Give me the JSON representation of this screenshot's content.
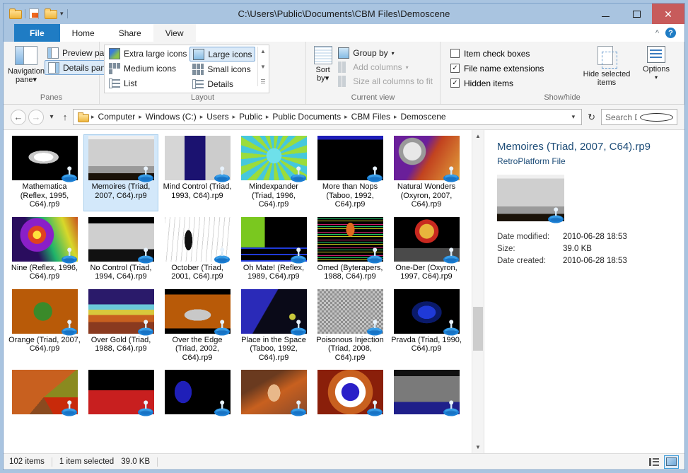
{
  "window": {
    "title": "C:\\Users\\Public\\Documents\\CBM Files\\Demoscene",
    "minimize_label": "Minimize",
    "maximize_label": "Maximize",
    "close_label": "Close",
    "help_label": "?",
    "collapse_ribbon_label": "^"
  },
  "quick_access": {
    "folder_icon": "folder-icon",
    "properties_icon": "properties-icon",
    "new_folder_icon": "new-folder-icon",
    "dropdown_icon": "chevron-down-icon"
  },
  "tabs": [
    {
      "label": "File",
      "state": "file"
    },
    {
      "label": "Home",
      "state": "normal"
    },
    {
      "label": "Share",
      "state": "normal"
    },
    {
      "label": "View",
      "state": "selected"
    }
  ],
  "ribbon": {
    "groups": [
      {
        "title": "Panes",
        "big_button": {
          "label_line1": "Navigation",
          "label_line2": "pane",
          "icon": "navigation-pane-icon"
        },
        "items": [
          {
            "label": "Preview pane",
            "icon": "preview-pane-icon",
            "highlighted": false
          },
          {
            "label": "Details pane",
            "icon": "details-pane-icon",
            "highlighted": true
          }
        ]
      },
      {
        "title": "Layout",
        "items": [
          {
            "label": "Extra large icons",
            "icon": "extra-large-icons-icon",
            "highlighted": false
          },
          {
            "label": "Medium icons",
            "icon": "medium-icons-icon",
            "highlighted": false
          },
          {
            "label": "List",
            "icon": "list-icon",
            "highlighted": false
          },
          {
            "label": "Large icons",
            "icon": "large-icons-icon",
            "highlighted": true
          },
          {
            "label": "Small icons",
            "icon": "small-icons-icon",
            "highlighted": false
          },
          {
            "label": "Details",
            "icon": "details-icon",
            "highlighted": false
          }
        ],
        "spinner": {
          "up": "▲",
          "down": "▼",
          "more": "☰"
        }
      },
      {
        "title": "Current view",
        "big_button": {
          "label_line1": "Sort",
          "label_line2": "by",
          "icon": "sort-by-icon"
        },
        "items": [
          {
            "label": "Group by",
            "icon": "group-by-icon",
            "disabled": false,
            "dropdown": true
          },
          {
            "label": "Add columns",
            "icon": "add-columns-icon",
            "disabled": true,
            "dropdown": true
          },
          {
            "label": "Size all columns to fit",
            "icon": "size-columns-icon",
            "disabled": true,
            "dropdown": false
          }
        ]
      },
      {
        "title": "Show/hide",
        "checkboxes": [
          {
            "label": "Item check boxes",
            "checked": false
          },
          {
            "label": "File name extensions",
            "checked": true
          },
          {
            "label": "Hidden items",
            "checked": true
          }
        ],
        "hide_selected": {
          "label_line1": "Hide selected",
          "label_line2": "items",
          "icon": "hide-selected-items-icon"
        },
        "options": {
          "label": "Options",
          "icon": "options-icon",
          "dropdown": "▾"
        }
      }
    ]
  },
  "address_bar": {
    "back_icon": "back-arrow-icon",
    "forward_icon": "forward-arrow-icon",
    "recent_icon": "chevron-down-icon",
    "up_icon": "up-arrow-icon",
    "folder_icon": "folder-icon",
    "crumbs": [
      "Computer",
      "Windows (C:)",
      "Users",
      "Public",
      "Public Documents",
      "CBM Files",
      "Demoscene"
    ],
    "separator": "▸",
    "dropdown_icon": "chevron-down-icon",
    "refresh_icon": "refresh-icon",
    "search_placeholder": "Search De...",
    "search_value": "",
    "search_icon": "search-icon"
  },
  "files": [
    {
      "name": "Mathematica (Reflex, 1995, C64).rp9",
      "selected": false,
      "thumb": "mathematica"
    },
    {
      "name": "Memoires (Triad, 2007, C64).rp9",
      "selected": true,
      "thumb": "memoires"
    },
    {
      "name": "Mind Control (Triad, 1993, C64).rp9",
      "selected": false,
      "thumb": "mindcontrol"
    },
    {
      "name": "Mindexpander (Triad, 1996, C64).rp9",
      "selected": false,
      "thumb": "mindexpander"
    },
    {
      "name": "More than Nops (Taboo, 1992, C64).rp9",
      "selected": false,
      "thumb": "morethannops"
    },
    {
      "name": "Natural Wonders (Oxyron, 2007, C64).rp9",
      "selected": false,
      "thumb": "naturalwonders"
    },
    {
      "name": "Nine (Reflex, 1996, C64).rp9",
      "selected": false,
      "thumb": "nine"
    },
    {
      "name": "No Control (Triad, 1994, C64).rp9",
      "selected": false,
      "thumb": "nocontrol"
    },
    {
      "name": "October (Triad, 2001, C64).rp9",
      "selected": false,
      "thumb": "october"
    },
    {
      "name": "Oh Mate! (Reflex, 1989, C64).rp9",
      "selected": false,
      "thumb": "ohmate"
    },
    {
      "name": "Omed (Byterapers, 1988, C64).rp9",
      "selected": false,
      "thumb": "omed"
    },
    {
      "name": "One-Der (Oxyron, 1997, C64).rp9",
      "selected": false,
      "thumb": "oneder"
    },
    {
      "name": "Orange (Triad, 2007, C64).rp9",
      "selected": false,
      "thumb": "orange"
    },
    {
      "name": "Over Gold (Triad, 1988, C64).rp9",
      "selected": false,
      "thumb": "overgold"
    },
    {
      "name": "Over the Edge (Triad, 2002, C64).rp9",
      "selected": false,
      "thumb": "overtheedge"
    },
    {
      "name": "Place in the Space (Taboo, 1992, C64).rp9",
      "selected": false,
      "thumb": "placeinspace"
    },
    {
      "name": "Poisonous Injection (Triad, 2008, C64).rp9",
      "selected": false,
      "thumb": "poisonous"
    },
    {
      "name": "Pravda (Triad, 1990, C64).rp9",
      "selected": false,
      "thumb": "pravda"
    },
    {
      "name": "",
      "selected": false,
      "thumb": "radiocore"
    },
    {
      "name": "",
      "selected": false,
      "thumb": "krasny"
    },
    {
      "name": "",
      "selected": false,
      "thumb": "tunnel"
    },
    {
      "name": "",
      "selected": false,
      "thumb": "medusa"
    },
    {
      "name": "",
      "selected": false,
      "thumb": "eye"
    },
    {
      "name": "",
      "selected": false,
      "thumb": "revolution"
    }
  ],
  "details_pane": {
    "title": "Memoires (Triad, 2007, C64).rp9",
    "file_type": "RetroPlatform File",
    "rows": [
      {
        "key": "Date modified:",
        "value": "2010-06-28 18:53"
      },
      {
        "key": "Size:",
        "value": "39.0 KB"
      },
      {
        "key": "Date created:",
        "value": "2010-06-28 18:53"
      }
    ]
  },
  "status_bar": {
    "item_count": "102 items",
    "selection": "1 item selected",
    "selection_size": "39.0 KB",
    "view_details_icon": "details-view-icon",
    "view_large_icons_icon": "large-icons-view-icon",
    "active_view": "large-icons"
  },
  "colors": {
    "titlebar": "#a9c4e0",
    "accent_blue": "#1f7cc4",
    "close_red": "#c75b5b",
    "selection": "#d3e8fa",
    "details_text": "#1f4e79"
  }
}
